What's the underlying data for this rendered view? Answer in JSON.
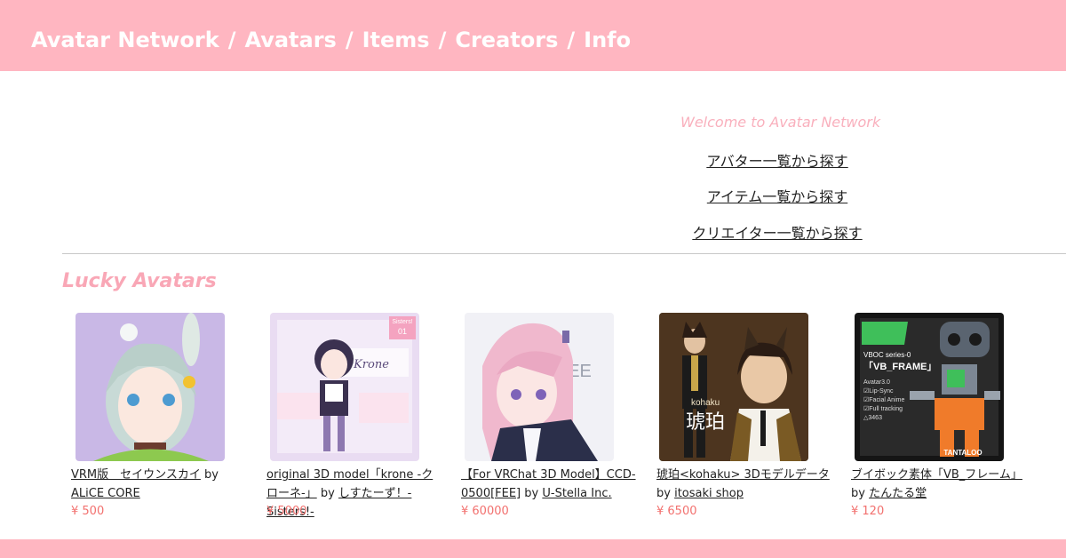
{
  "header": {
    "nav": [
      {
        "label": "Avatar Network"
      },
      {
        "label": "Avatars"
      },
      {
        "label": "Items"
      },
      {
        "label": "Creators"
      },
      {
        "label": "Info"
      }
    ],
    "separator": "/"
  },
  "hero": {
    "welcome": "Welcome to Avatar Network",
    "links": [
      {
        "label": "アバター一覧から探す"
      },
      {
        "label": "アイテム一覧から探す"
      },
      {
        "label": "クリエイター一覧から探す"
      }
    ]
  },
  "lucky": {
    "title": "Lucky Avatars",
    "by": "by",
    "items": [
      {
        "title": "VRM版　セイウンスカイ",
        "creator": "ALiCE CORE",
        "price": "¥ 500"
      },
      {
        "title": "original 3D model「krone -クローネ-」",
        "creator": "しすたーず！-Sisters!-",
        "price": "¥ 5000"
      },
      {
        "title": "【For VRChat 3D Model】CCD-0500[FEE]",
        "creator": "U-Stella Inc.",
        "price": "¥ 60000"
      },
      {
        "title": "琥珀<kohaku> 3Dモデルデータ",
        "creator": "itosaki shop",
        "price": "¥ 6500"
      },
      {
        "title": "ブイボック素体「VB_フレーム」",
        "creator": "たんたる堂",
        "price": "¥ 120"
      }
    ],
    "thumb_texts": {
      "krone_tag": "Sisters!",
      "krone_num": "01",
      "krone_name": "Krone",
      "fee": "FEE",
      "kohaku_name": "kohaku",
      "kohaku_kanji": "琥珀",
      "vb_series": "VBOC series-0",
      "vb_frame": "「VB_FRAME」",
      "vb_spec": "Avatar3.0",
      "vb_spec2": "☑Lip-Sync",
      "vb_spec3": "☑Facial Anime",
      "vb_spec4": "☑Full tracking",
      "vb_poly": "△3463",
      "vb_brand": "TANTALOO"
    }
  },
  "colors": {
    "brand_pink": "#ffb6c1",
    "accent_pink": "#f9a7b6",
    "price_red": "#f2706e"
  }
}
